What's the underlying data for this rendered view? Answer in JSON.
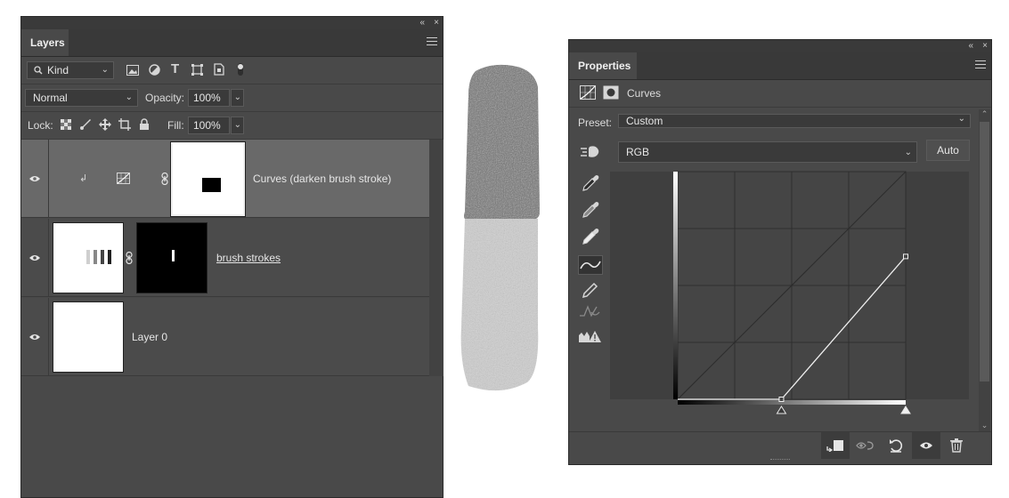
{
  "layers_panel": {
    "collapse": "«",
    "close": "×",
    "tab": "Layers",
    "filter": {
      "label": "Kind"
    },
    "blend_mode": "Normal",
    "opacity": {
      "label": "Opacity:",
      "value": "100%"
    },
    "lock": {
      "label": "Lock:"
    },
    "fill": {
      "label": "Fill:",
      "value": "100%"
    },
    "layers": [
      {
        "name": "Curves (darken brush stroke)"
      },
      {
        "name": "brush strokes"
      },
      {
        "name": "Layer 0"
      }
    ]
  },
  "properties_panel": {
    "collapse": "«",
    "close": "×",
    "tab": "Properties",
    "adjustment_title": "Curves",
    "preset": {
      "label": "Preset:",
      "value": "Custom"
    },
    "channel": "RGB",
    "auto_button": "Auto",
    "curve": {
      "input_range": [
        0,
        255
      ],
      "points": [
        [
          0,
          0
        ],
        [
          116,
          0
        ],
        [
          255,
          160
        ]
      ],
      "black_point": 116,
      "white_point": 255
    }
  }
}
